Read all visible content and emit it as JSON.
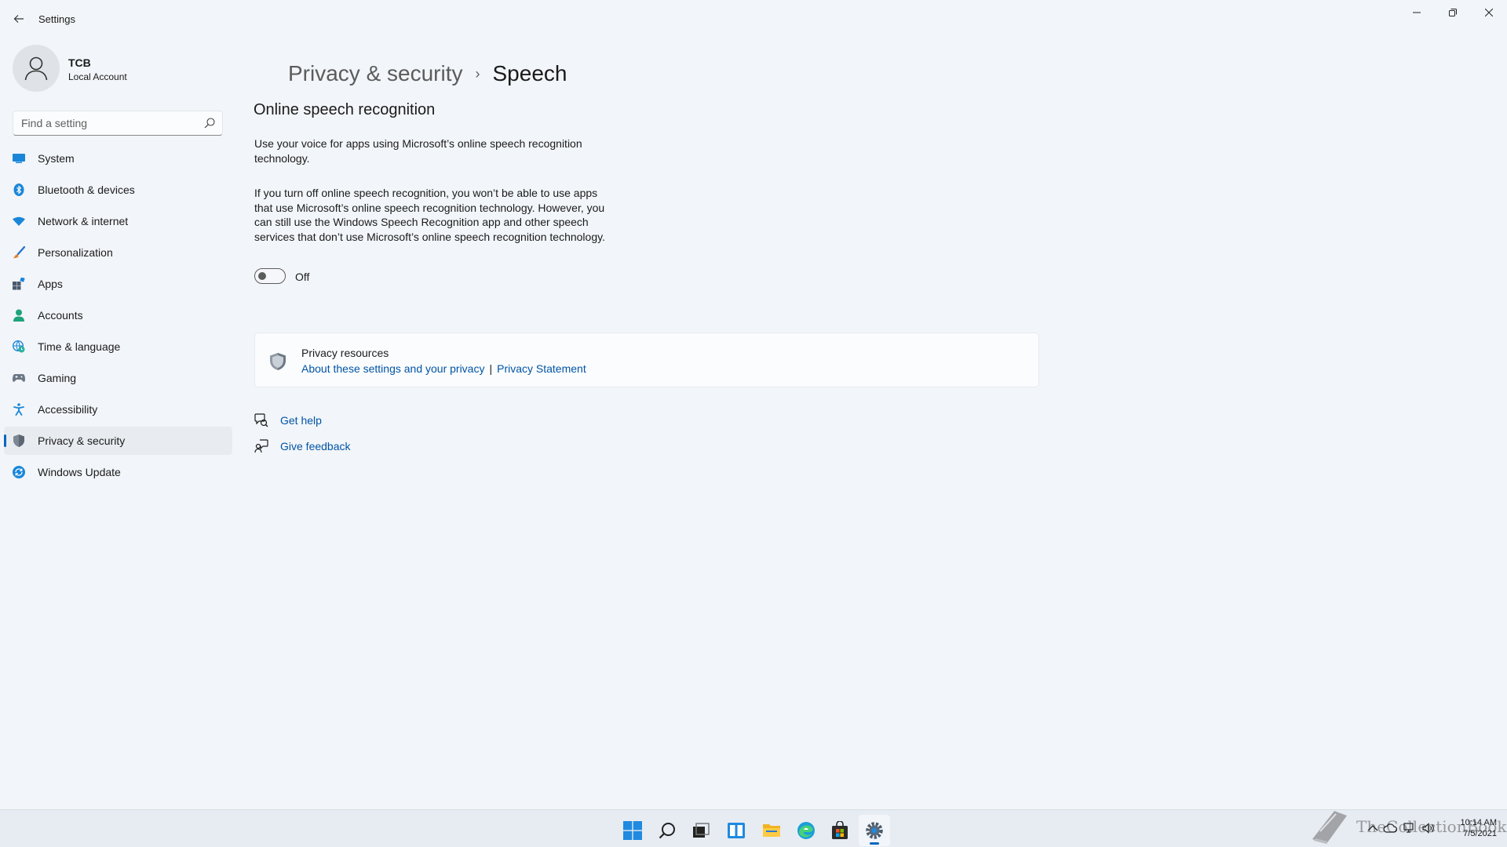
{
  "window": {
    "title": "Settings",
    "controls": {
      "minimize": "minimize-icon",
      "maximize": "restore-icon",
      "close": "close-icon"
    }
  },
  "profile": {
    "name": "TCB",
    "account_type": "Local Account"
  },
  "search": {
    "placeholder": "Find a setting"
  },
  "sidebar": {
    "items": [
      {
        "label": "System",
        "icon": "system-icon"
      },
      {
        "label": "Bluetooth & devices",
        "icon": "bluetooth-icon"
      },
      {
        "label": "Network & internet",
        "icon": "wifi-icon"
      },
      {
        "label": "Personalization",
        "icon": "brush-icon"
      },
      {
        "label": "Apps",
        "icon": "apps-icon"
      },
      {
        "label": "Accounts",
        "icon": "person-icon"
      },
      {
        "label": "Time & language",
        "icon": "globe-clock-icon"
      },
      {
        "label": "Gaming",
        "icon": "gamepad-icon"
      },
      {
        "label": "Accessibility",
        "icon": "accessibility-icon"
      },
      {
        "label": "Privacy & security",
        "icon": "shield-icon",
        "active": true
      },
      {
        "label": "Windows Update",
        "icon": "update-icon"
      }
    ]
  },
  "breadcrumb": {
    "parent": "Privacy & security",
    "separator": "›",
    "current": "Speech"
  },
  "main": {
    "section_title": "Online speech recognition",
    "description_1": "Use your voice for apps using Microsoft’s online speech recognition technology.",
    "description_2": "If you turn off online speech recognition, you won’t be able to use apps that use Microsoft’s online speech recognition technology.  However, you can still use the Windows Speech Recognition app and other speech services that don’t use Microsoft’s online speech recognition technology.",
    "toggle": {
      "state": "off",
      "label": "Off"
    }
  },
  "resources": {
    "title": "Privacy resources",
    "link_1": "About these settings and your privacy",
    "divider": "|",
    "link_2": "Privacy Statement"
  },
  "help": {
    "get_help": "Get help",
    "give_feedback": "Give feedback"
  },
  "taskbar": {
    "apps": [
      "start-icon",
      "search-icon",
      "task-view-icon",
      "widgets-icon",
      "file-explorer-icon",
      "edge-icon",
      "store-icon",
      "settings-icon"
    ],
    "active_app": "settings-icon"
  },
  "tray": {
    "time": "10:14 AM",
    "date": "7/5/2021",
    "icons": [
      "chevron-up-icon",
      "cloud-icon",
      "network-icon",
      "volume-icon"
    ]
  },
  "watermark": {
    "text": "TheCollectionBook"
  },
  "colors": {
    "accent": "#0067c0",
    "link": "#0054a6",
    "background": "#f2f5f9"
  }
}
